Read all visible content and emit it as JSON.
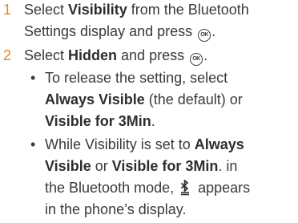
{
  "steps": [
    {
      "number": "1",
      "lines": [
        [
          "Select ",
          "Visibility",
          " from the Bluetooth"
        ],
        [
          "Settings display and press ",
          "OK",
          "."
        ]
      ]
    },
    {
      "number": "2",
      "line": [
        "Select ",
        "Hidden",
        " and press ",
        "OK",
        "."
      ]
    }
  ],
  "bullets": [
    {
      "symbol": "•",
      "lines": [
        "To release the setting, select",
        [
          "Always Visible",
          " (the default) or"
        ],
        [
          "Visible for 3Min",
          "."
        ]
      ]
    },
    {
      "symbol": "•",
      "lines": [
        [
          "While Visibility is set to ",
          "Always"
        ],
        [
          "Visible",
          " or ",
          "Visible for 3Min",
          ". in"
        ],
        [
          "the Bluetooth mode, ",
          "bluetooth-icon",
          " appears"
        ],
        "in the phone’s display."
      ]
    }
  ],
  "colors": {
    "step_number": "#e8852d",
    "text": "#3a3a3a"
  }
}
